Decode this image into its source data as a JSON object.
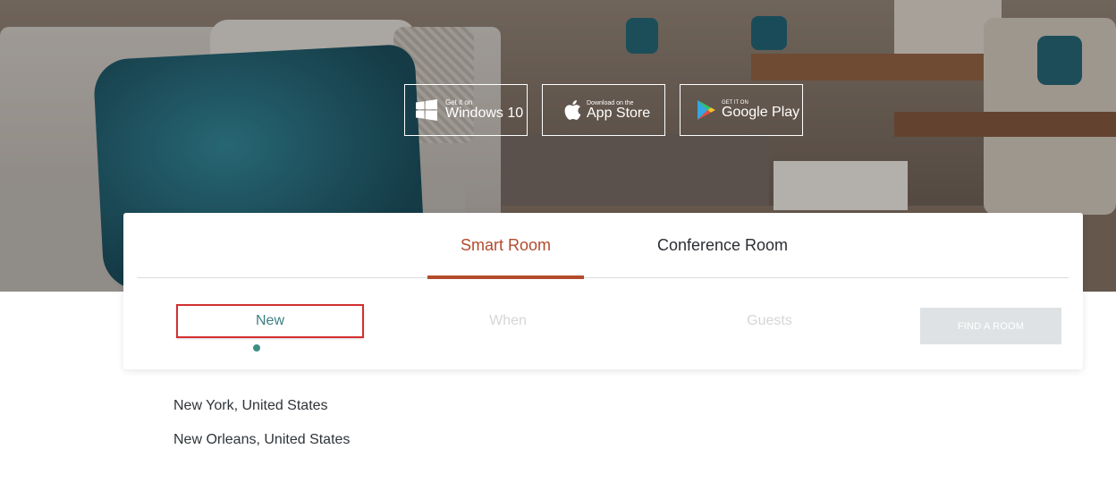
{
  "badges": {
    "windows": {
      "small": "Get it on",
      "big": "Windows 10",
      "icon": "windows-logo-icon"
    },
    "appstore": {
      "small": "Download on the",
      "big": "App Store",
      "icon": "apple-logo-icon"
    },
    "googleplay": {
      "small": "GET IT ON",
      "big": "Google Play",
      "icon": "google-play-logo-icon"
    }
  },
  "tabs": [
    {
      "label": "Smart Room",
      "active": true
    },
    {
      "label": "Conference Room",
      "active": false
    }
  ],
  "search": {
    "where_value": "New",
    "when_placeholder": "When",
    "guests_placeholder": "Guests",
    "find_button": "FIND A ROOM"
  },
  "suggestions": [
    "New York, United States",
    "New Orleans, United States"
  ],
  "colors": {
    "accent": "#b34a2c",
    "teal": "#3e7e82",
    "highlight_border": "#d32f2f",
    "button_disabled": "#dfe2e4"
  }
}
